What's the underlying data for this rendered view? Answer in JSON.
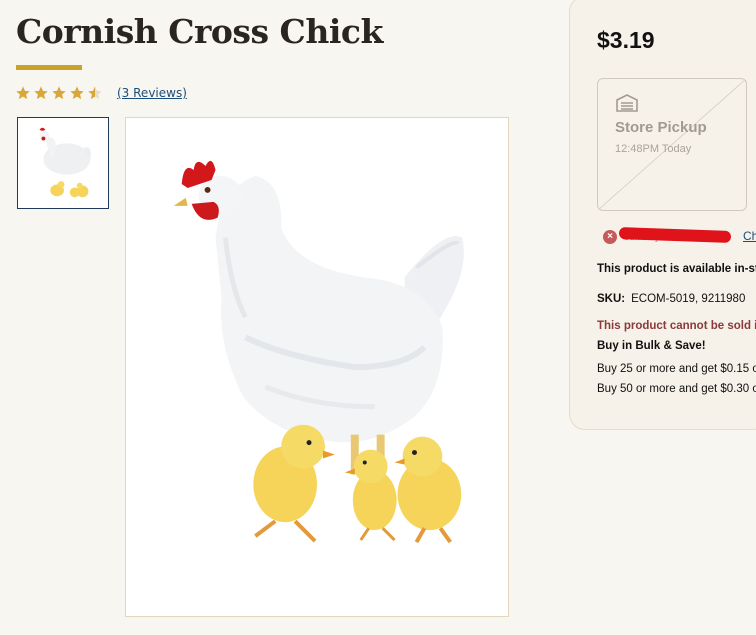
{
  "product": {
    "title": "Cornish Cross Chick",
    "rating": 4.5,
    "reviews_link": "(3 Reviews)",
    "thumbnail_alt": "Cornish Cross Chick",
    "main_image_alt": "Cornish Cross Chick"
  },
  "purchase_panel": {
    "price": "$3.19",
    "pickup": {
      "label": "Store Pickup",
      "time": "12:48PM Today"
    },
    "stock_status": "Currently Out of Stock at",
    "change_store_link": "Ch",
    "availability": "This product is available in-sto",
    "sku_label": "SKU:",
    "sku_value": "ECOM-5019, 9211980",
    "restriction": "This product cannot be sold in",
    "bulk_title": "Buy in Bulk & Save!",
    "bulk_offers": [
      "Buy 25 or more and get $0.15 o",
      "Buy 50 or more and get $0.30 o"
    ]
  },
  "colors": {
    "accent_gold": "#c9a227",
    "star_gold": "#d9a63a",
    "link_blue": "#1b4d7a",
    "error_red": "#c55a5a",
    "redaction_red": "#e0131b"
  },
  "icons": [
    "star-icon",
    "star-half-icon",
    "store-icon",
    "close-circle-icon"
  ]
}
